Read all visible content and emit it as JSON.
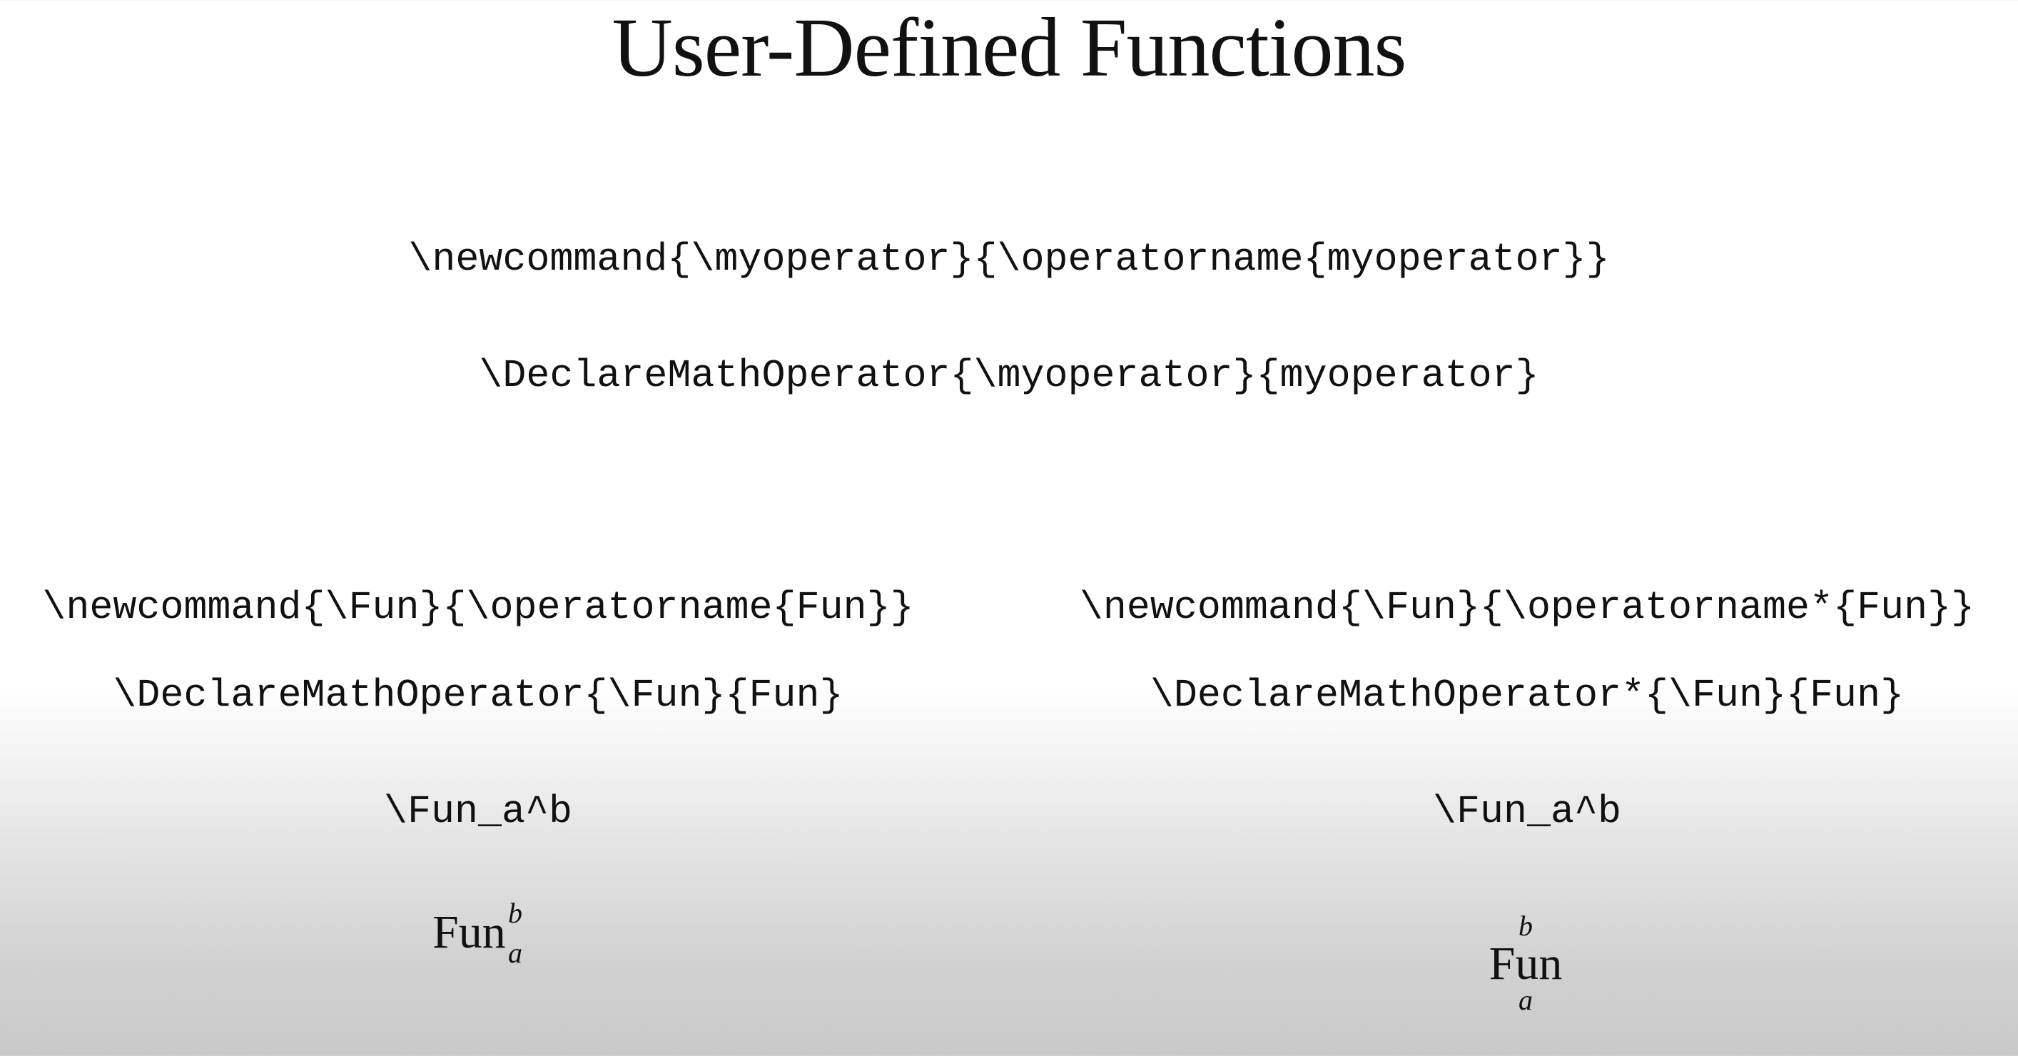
{
  "slide": {
    "title": "User-Defined Functions",
    "top_block": {
      "newcommand": "\\newcommand{\\myoperator}{\\operatorname{myoperator}}",
      "declare": "\\DeclareMathOperator{\\myoperator}{myoperator}"
    },
    "left_column": {
      "newcommand": "\\newcommand{\\Fun}{\\operatorname{Fun}}",
      "declare": "\\DeclareMathOperator{\\Fun}{Fun}",
      "usage": "\\Fun_a^b",
      "rendered": {
        "base": "Fun",
        "sup": "b",
        "sub": "a"
      }
    },
    "right_column": {
      "newcommand": "\\newcommand{\\Fun}{\\operatorname*{Fun}}",
      "declare": "\\DeclareMathOperator*{\\Fun}{Fun}",
      "usage": "\\Fun_a^b",
      "rendered": {
        "base": "Fun",
        "sup": "b",
        "sub": "a"
      }
    }
  }
}
